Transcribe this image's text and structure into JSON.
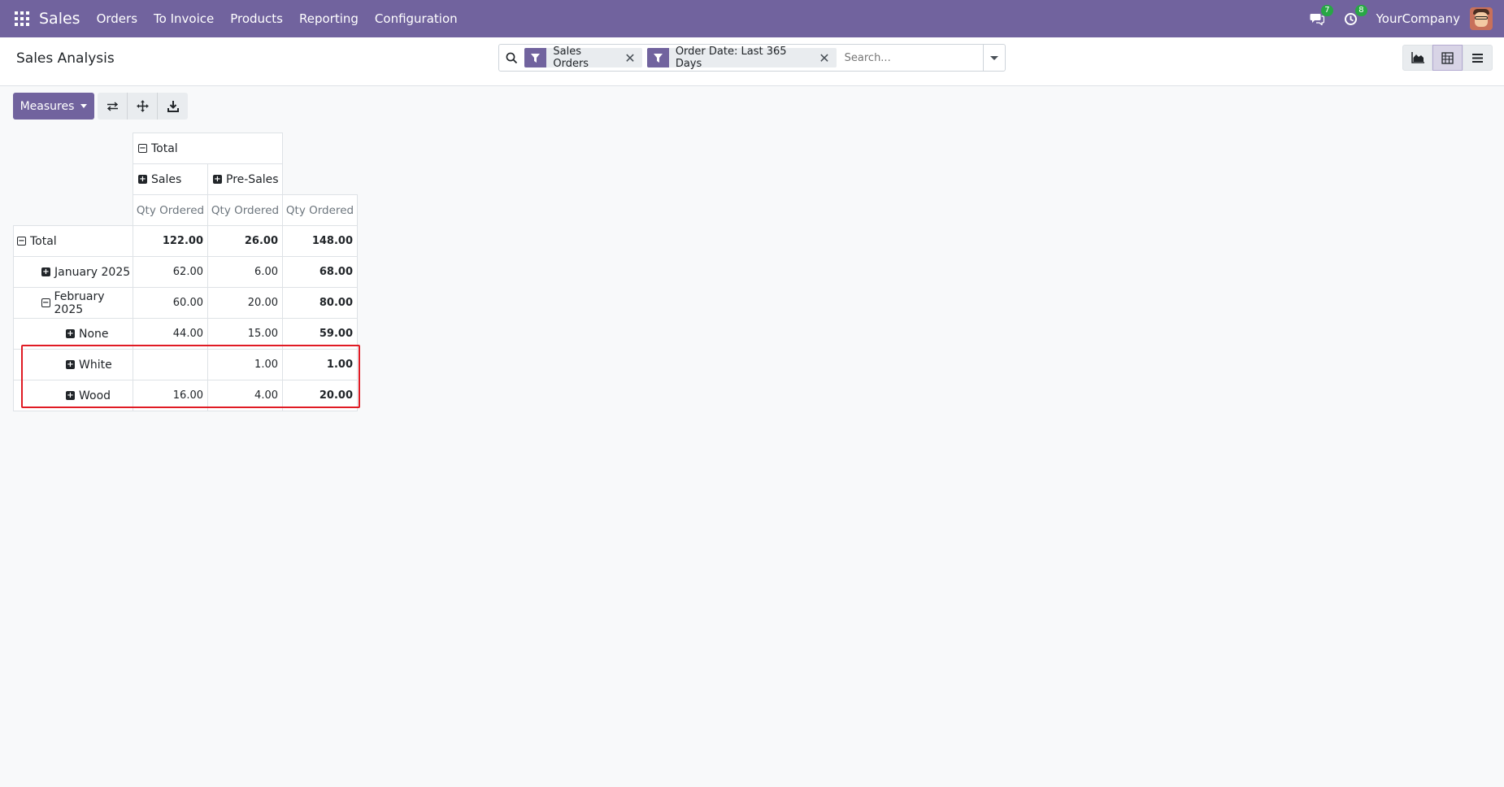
{
  "navbar": {
    "app_name": "Sales",
    "menu": [
      "Orders",
      "To Invoice",
      "Products",
      "Reporting",
      "Configuration"
    ],
    "messages_count": "7",
    "activities_count": "8",
    "company": "YourCompany",
    "accent_color": "#71639e"
  },
  "control_panel": {
    "title": "Sales Analysis",
    "facets": [
      {
        "label": "Sales Orders",
        "icon": "filter-icon"
      },
      {
        "label": "Order Date: Last 365 Days",
        "icon": "filter-icon"
      }
    ],
    "search_placeholder": "Search...",
    "views": [
      "graph-view",
      "pivot-view",
      "list-view"
    ],
    "active_view": "pivot-view"
  },
  "toolbar": {
    "measures_label": "Measures",
    "tools": [
      "flip-axis-icon",
      "expand-all-icon",
      "download-icon"
    ]
  },
  "pivot": {
    "col_total_label": "Total",
    "col_groups": [
      "Sales",
      "Pre-Sales"
    ],
    "measure_label": "Qty Ordered",
    "rows": [
      {
        "label": "Total",
        "toggle": "minus",
        "level": 0,
        "values": [
          "122.00",
          "26.00",
          "148.00"
        ]
      },
      {
        "label": "January 2025",
        "toggle": "plus",
        "level": 1,
        "values": [
          "62.00",
          "6.00",
          "68.00"
        ]
      },
      {
        "label": "February 2025",
        "toggle": "minus",
        "level": 1,
        "values": [
          "60.00",
          "20.00",
          "80.00"
        ]
      },
      {
        "label": "None",
        "toggle": "plus",
        "level": 2,
        "values": [
          "44.00",
          "15.00",
          "59.00"
        ]
      },
      {
        "label": "White",
        "toggle": "plus",
        "level": 2,
        "values": [
          "",
          "1.00",
          "1.00"
        ]
      },
      {
        "label": "Wood",
        "toggle": "plus",
        "level": 2,
        "values": [
          "16.00",
          "4.00",
          "20.00"
        ]
      }
    ],
    "highlight_color": "#e01b24"
  }
}
